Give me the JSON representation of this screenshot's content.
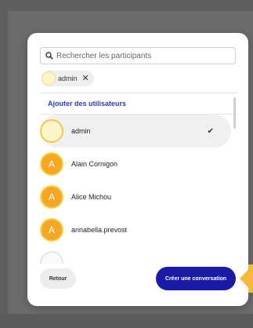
{
  "search": {
    "placeholder": "Rechercher les participants"
  },
  "selected_chip": {
    "label": "admin",
    "close": "✕"
  },
  "add_users_label": "Ajouter des utilisateurs",
  "users": [
    {
      "initial": "",
      "name": "admin",
      "selected": true,
      "check": "✔"
    },
    {
      "initial": "A",
      "name": "Alain Cornigon",
      "selected": false
    },
    {
      "initial": "A",
      "name": "Alice Michou",
      "selected": false
    },
    {
      "initial": "A",
      "name": "annabella.prevost",
      "selected": false
    }
  ],
  "buttons": {
    "back": "Retour",
    "create": "Créer une conversation"
  },
  "colors": {
    "accent": "#1a1aa6",
    "avatar_orange": "#f5a623",
    "link": "#2b3fb8",
    "tooltip": "#f6b93b"
  }
}
